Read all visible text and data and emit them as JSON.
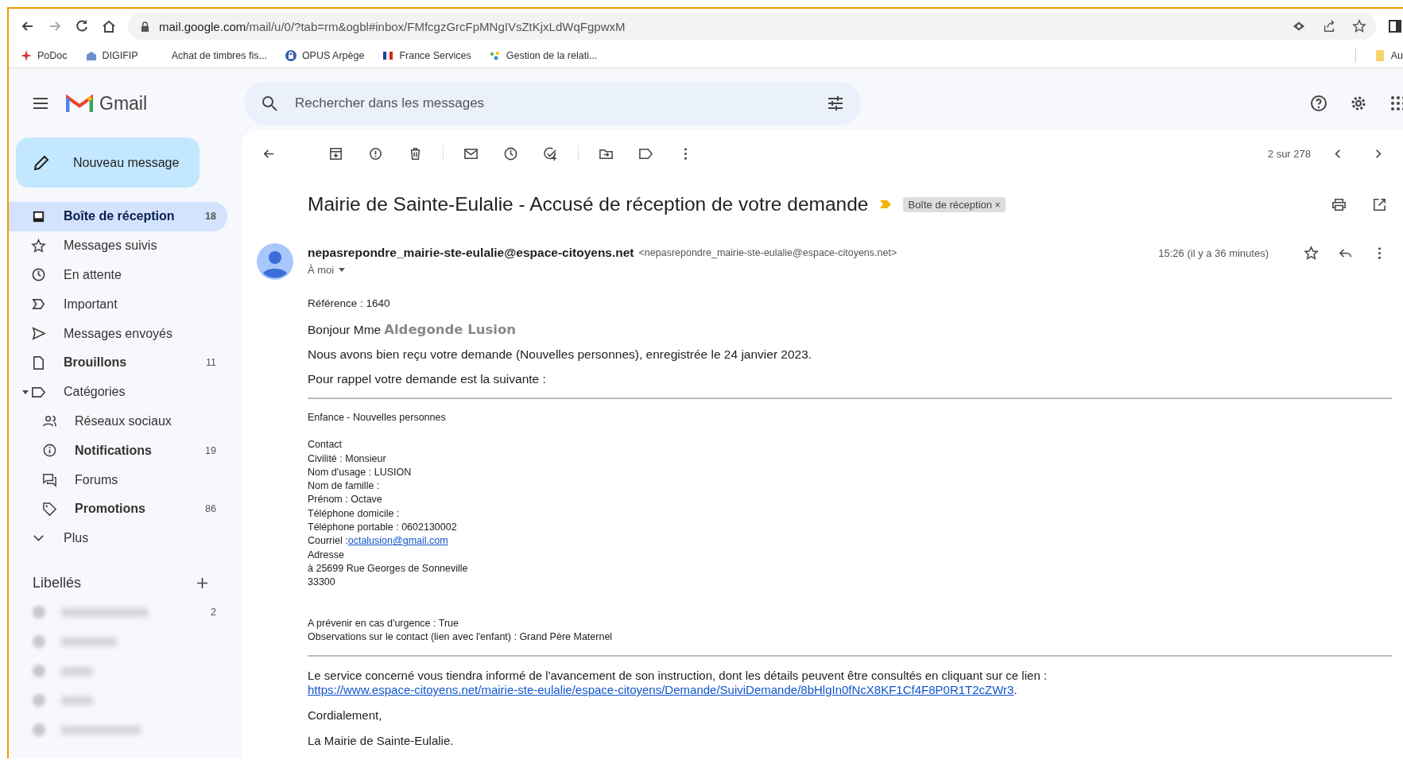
{
  "browser": {
    "url_host": "mail.google.com",
    "url_path": "/mail/u/0/?tab=rm&ogbl#inbox/FMfcgzGrcFpMNgIVsZtKjxLdWqFgpwxM",
    "bookmarks": [
      {
        "label": "PoDoc"
      },
      {
        "label": "DIGIFIP"
      },
      {
        "label": "Achat de timbres fis..."
      },
      {
        "label": "OPUS Arpège"
      },
      {
        "label": "France Services"
      },
      {
        "label": "Gestion de la relati..."
      }
    ],
    "bookmark_folder": "Au"
  },
  "gmail": {
    "app_name": "Gmail",
    "search": {
      "placeholder": "Rechercher dans les messages"
    }
  },
  "sidebar": {
    "compose": "Nouveau message",
    "items": [
      {
        "label": "Boîte de réception",
        "count": "18",
        "unread": true,
        "selected": true
      },
      {
        "label": "Messages suivis",
        "unread": false,
        "selected": false
      },
      {
        "label": "En attente",
        "unread": false,
        "selected": false
      },
      {
        "label": "Important",
        "unread": false,
        "selected": false
      },
      {
        "label": "Messages envoyés",
        "unread": false,
        "selected": false
      },
      {
        "label": "Brouillons",
        "count": "11",
        "unread": true,
        "selected": false
      },
      {
        "label": "Catégories",
        "unread": false,
        "selected": false,
        "expanded": true,
        "children": [
          {
            "label": "Réseaux sociaux",
            "unread": false,
            "selected": false
          },
          {
            "label": "Notifications",
            "count": "19",
            "unread": true,
            "selected": false
          },
          {
            "label": "Forums",
            "unread": false,
            "selected": false
          },
          {
            "label": "Promotions",
            "count": "86",
            "unread": true,
            "selected": false
          }
        ]
      },
      {
        "label": "Plus",
        "unread": false,
        "selected": false
      }
    ],
    "labels_title": "Libellés",
    "first_label_count": "2"
  },
  "message": {
    "position": "2 sur 278",
    "subject": "Mairie de Sainte-Eulalie - Accusé de réception de votre demande",
    "important": true,
    "label_chip": {
      "label": "Boîte de réception",
      "remove": "×"
    },
    "sender_name": "nepasrepondre_mairie-ste-eulalie@espace-citoyens.net",
    "sender_email": "<nepasrepondre_mairie-ste-eulalie@espace-citoyens.net>",
    "recipient": "À moi",
    "time": "15:26 (il y a 36 minutes)",
    "starred": false,
    "reference": "Référence : 1640",
    "greeting": "Bonjour Mme",
    "greeting_name": "Aldegonde Lusion",
    "intro": "Nous avons bien reçu votre demande (Nouvelles personnes), enregistrée le 24 janvier 2023.",
    "reminder": "Pour rappel votre demande est la suivante :",
    "detail_blocks": [
      [
        {
          "text": "Enfance - Nouvelles personnes"
        }
      ],
      [
        {
          "text": "Contact"
        },
        {
          "text": "Civilité : Monsieur"
        },
        {
          "text": "Nom d'usage : LUSION"
        },
        {
          "text": "Nom de famille :"
        },
        {
          "text": "Prénom : Octave"
        },
        {
          "text": "Téléphone domicile :"
        },
        {
          "text": "Téléphone portable : 0602130002"
        },
        {
          "text": "Courriel :",
          "link": "octalusion@gmail.com"
        },
        {
          "text": "Adresse"
        },
        {
          "text": "à 25699 Rue Georges de Sonneville"
        },
        {
          "text": "33300"
        }
      ],
      [
        {
          "text": "A prévenir en cas d'urgence : True"
        },
        {
          "text": "Observations sur le contact (lien avec l'enfant) : Grand Père Maternel"
        }
      ]
    ],
    "followup": "Le service concerné vous tiendra informé de l'avancement de son instruction, dont les détails peuvent être consultés en cliquant sur ce lien :",
    "followup_link": "https://www.espace-citoyens.net/mairie-ste-eulalie/espace-citoyens/Demande/SuiviDemande/8bHlgIn0fNcX8KF1Cf4F8P0R1T2cZWr3",
    "followup_end": ".",
    "closing": "Cordialement,",
    "signature": "La Mairie de Sainte-Eulalie."
  }
}
